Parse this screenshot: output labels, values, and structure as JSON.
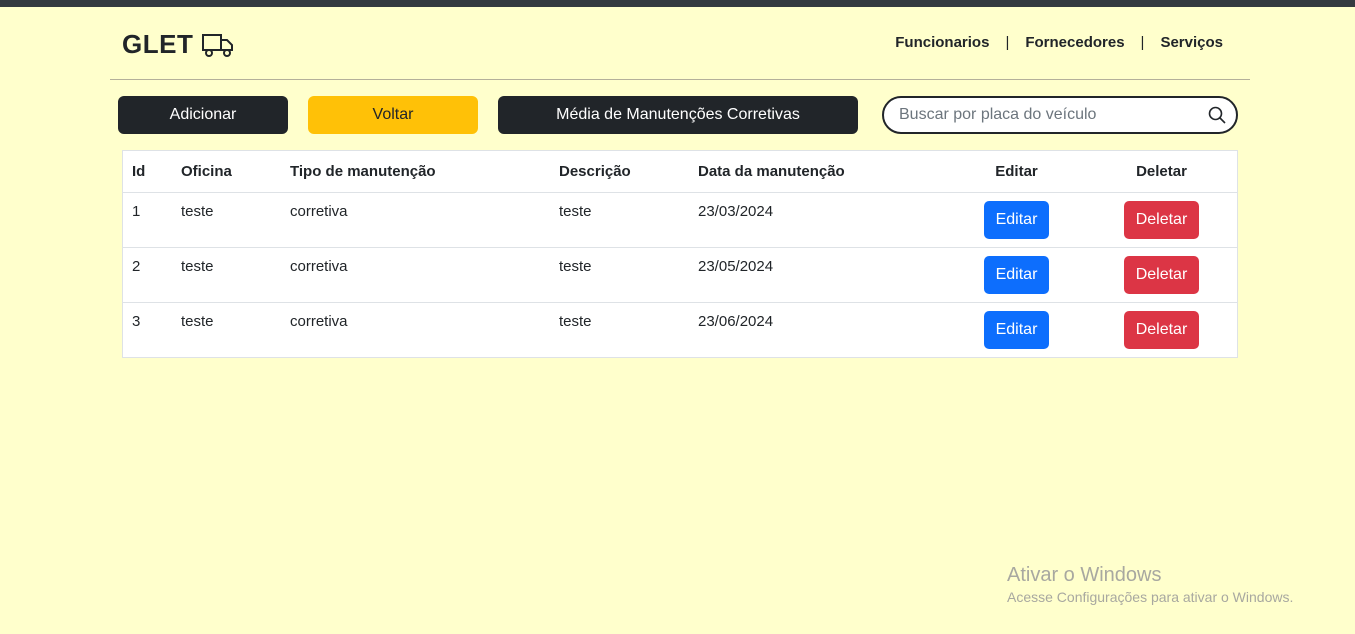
{
  "brand": {
    "name": "GLET",
    "icon": "truck-icon"
  },
  "nav": {
    "links": [
      "Funcionarios",
      "Fornecedores",
      "Serviços"
    ],
    "separator": "|"
  },
  "toolbar": {
    "add_label": "Adicionar",
    "back_label": "Voltar",
    "average_label": "Média de Manutenções Corretivas"
  },
  "search": {
    "placeholder": "Buscar por placa do veículo",
    "value": "",
    "icon": "search-icon"
  },
  "table": {
    "headers": [
      "Id",
      "Oficina",
      "Tipo de manutenção",
      "Descrição",
      "Data da manutenção",
      "Editar",
      "Deletar"
    ],
    "rows": [
      {
        "id": "1",
        "oficina": "teste",
        "tipo": "corretiva",
        "descricao": "teste",
        "data": "23/03/2024",
        "edit": "Editar",
        "delete": "Deletar"
      },
      {
        "id": "2",
        "oficina": "teste",
        "tipo": "corretiva",
        "descricao": "teste",
        "data": "23/05/2024",
        "edit": "Editar",
        "delete": "Deletar"
      },
      {
        "id": "3",
        "oficina": "teste",
        "tipo": "corretiva",
        "descricao": "teste",
        "data": "23/06/2024",
        "edit": "Editar",
        "delete": "Deletar"
      }
    ]
  },
  "watermark": {
    "title": "Ativar o Windows",
    "subtitle": "Acesse Configurações para ativar o Windows."
  },
  "colors": {
    "background": "#ffffcc",
    "dark": "#212529",
    "warning": "#ffc107",
    "primary": "#0d6efd",
    "danger": "#dc3545"
  }
}
